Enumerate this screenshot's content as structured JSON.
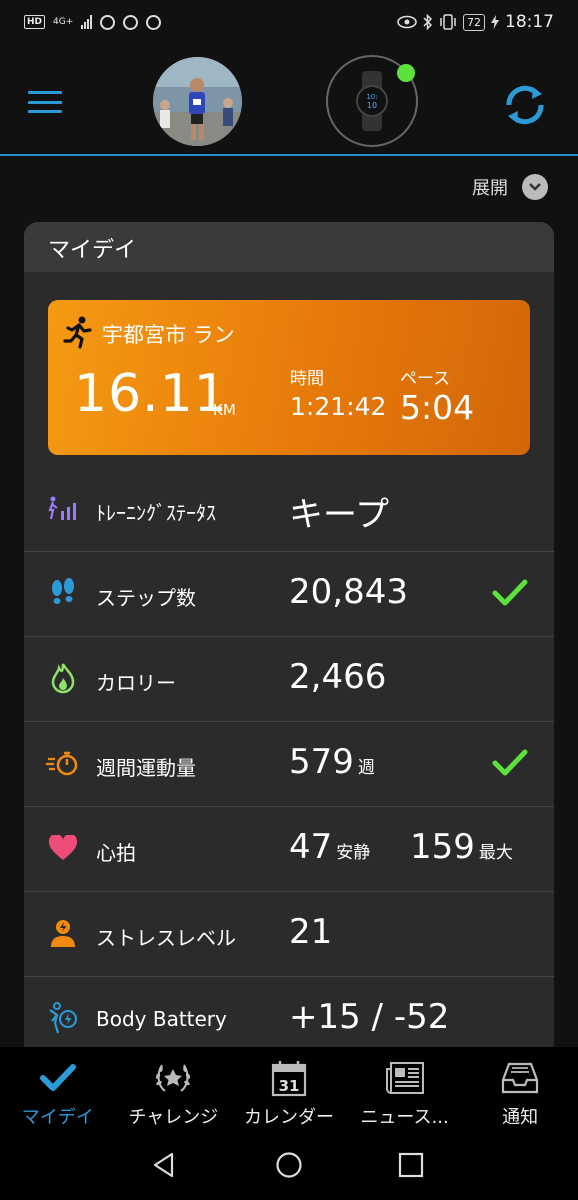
{
  "status_bar": {
    "network": "4G+",
    "battery": "72",
    "time": "18:17"
  },
  "header": {
    "avatar_label": "profile-photo",
    "device_status": "connected"
  },
  "expand_label": "展開",
  "card": {
    "title": "マイデイ",
    "activity": {
      "name": "宇都宮市 ラン",
      "distance": "16.11",
      "distance_unit": "KM",
      "time_label": "時間",
      "time_value": "1:21:42",
      "pace_label": "ペース",
      "pace_value": "5:04"
    },
    "metrics": [
      {
        "icon": "training-status-icon",
        "label": "ﾄﾚｰﾆﾝｸﾞｽﾃｰﾀｽ",
        "value": "キープ"
      },
      {
        "icon": "footsteps-icon",
        "label": "ステップ数",
        "value": "20,843",
        "check": true
      },
      {
        "icon": "flame-icon",
        "label": "カロリー",
        "value": "2,466"
      },
      {
        "icon": "stopwatch-icon",
        "label": "週間運動量",
        "value": "579",
        "unit": "週",
        "check": true
      },
      {
        "icon": "heart-icon",
        "label": "心拍",
        "value": "47",
        "unit": "安静",
        "value2": "159",
        "unit2": "最大"
      },
      {
        "icon": "stress-icon",
        "label": "ストレスレベル",
        "value": "21"
      },
      {
        "icon": "body-battery-icon",
        "label": "Body Battery",
        "value": "+15 / -52"
      }
    ]
  },
  "bottom_nav": [
    {
      "label": "マイデイ",
      "active": true
    },
    {
      "label": "チャレンジ"
    },
    {
      "label": "カレンダー",
      "calendar_day": "31"
    },
    {
      "label": "ニュース..."
    },
    {
      "label": "通知"
    }
  ],
  "colors": {
    "accent_blue": "#2d9ad8",
    "activity_orange": "#f08a10",
    "check_green": "#5de23c"
  }
}
